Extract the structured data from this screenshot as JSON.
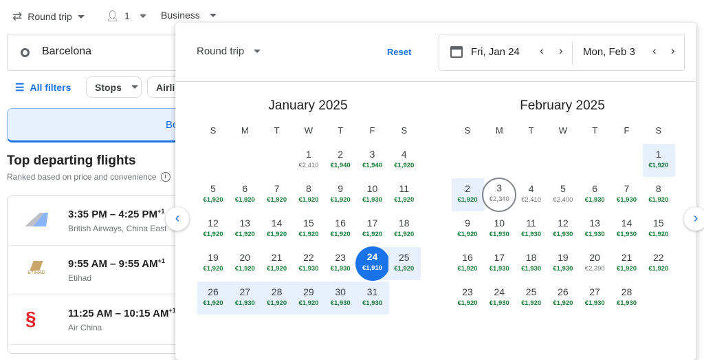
{
  "search": {
    "trip_type": "Round trip",
    "passengers": "1",
    "cabin": "Business",
    "origin": "Barcelona"
  },
  "filters": {
    "all_filters": "All filters",
    "stops": "Stops",
    "airlines": "Airlin"
  },
  "banner": {
    "text": "Be"
  },
  "results": {
    "title": "Top departing flights",
    "subtitle": "Ranked based on price and convenience",
    "flights": [
      {
        "time": "3:35 PM – 4:25 PM",
        "plus": "+1",
        "airline": "British Airways, China East"
      },
      {
        "time": "9:55 AM – 9:55 AM",
        "plus": "+1",
        "airline": "Etihad",
        "logo_text": "ETIHAD"
      },
      {
        "time": "11:25 AM – 10:15 AM",
        "plus": "+1",
        "airline": "Air China"
      }
    ]
  },
  "picker": {
    "trip_type": "Round trip",
    "reset": "Reset",
    "depart": "Fri, Jan 24",
    "return": "Mon, Feb 3",
    "weekdays": [
      "S",
      "M",
      "T",
      "W",
      "T",
      "F",
      "S"
    ],
    "colors": {
      "low": "#188038",
      "typical": "#70757a",
      "accent": "#1a73e8",
      "range": "#e8f0fe"
    },
    "months": [
      {
        "title": "January 2025",
        "first_weekday": 3,
        "selected_start": 24,
        "range": [
          25,
          31
        ],
        "days": [
          {
            "d": "1",
            "p": "€2,410",
            "l": "typical"
          },
          {
            "d": "2",
            "p": "€1,940",
            "l": "low"
          },
          {
            "d": "3",
            "p": "€1,940",
            "l": "low"
          },
          {
            "d": "4",
            "p": "€1,920",
            "l": "low"
          },
          {
            "d": "5",
            "p": "€1,920",
            "l": "low"
          },
          {
            "d": "6",
            "p": "€1,920",
            "l": "low"
          },
          {
            "d": "7",
            "p": "€1,920",
            "l": "low"
          },
          {
            "d": "8",
            "p": "€1,920",
            "l": "low"
          },
          {
            "d": "9",
            "p": "€1,920",
            "l": "low"
          },
          {
            "d": "10",
            "p": "€1,930",
            "l": "low"
          },
          {
            "d": "11",
            "p": "€1,920",
            "l": "low"
          },
          {
            "d": "12",
            "p": "€1,920",
            "l": "low"
          },
          {
            "d": "13",
            "p": "€1,920",
            "l": "low"
          },
          {
            "d": "14",
            "p": "€1,920",
            "l": "low"
          },
          {
            "d": "15",
            "p": "€1,920",
            "l": "low"
          },
          {
            "d": "16",
            "p": "€1,920",
            "l": "low"
          },
          {
            "d": "17",
            "p": "€1,920",
            "l": "low"
          },
          {
            "d": "18",
            "p": "€1,920",
            "l": "low"
          },
          {
            "d": "19",
            "p": "€1,920",
            "l": "low"
          },
          {
            "d": "20",
            "p": "€1,920",
            "l": "low"
          },
          {
            "d": "21",
            "p": "€1,920",
            "l": "low"
          },
          {
            "d": "22",
            "p": "€1,930",
            "l": "low"
          },
          {
            "d": "23",
            "p": "€1,930",
            "l": "low"
          },
          {
            "d": "24",
            "p": "€1,910",
            "l": "low"
          },
          {
            "d": "25",
            "p": "€1,920",
            "l": "low"
          },
          {
            "d": "26",
            "p": "€1,920",
            "l": "low"
          },
          {
            "d": "27",
            "p": "€1,930",
            "l": "low"
          },
          {
            "d": "28",
            "p": "€1,920",
            "l": "low"
          },
          {
            "d": "29",
            "p": "€1,920",
            "l": "low"
          },
          {
            "d": "30",
            "p": "€1,930",
            "l": "low"
          },
          {
            "d": "31",
            "p": "€1,930",
            "l": "low"
          }
        ]
      },
      {
        "title": "February 2025",
        "first_weekday": 6,
        "selected_end": 3,
        "range": [
          1,
          2
        ],
        "days": [
          {
            "d": "1",
            "p": "€1,920",
            "l": "low"
          },
          {
            "d": "2",
            "p": "€1,920",
            "l": "low"
          },
          {
            "d": "3",
            "p": "€2,340",
            "l": "typical"
          },
          {
            "d": "4",
            "p": "€2,410",
            "l": "typical"
          },
          {
            "d": "5",
            "p": "€2,400",
            "l": "typical"
          },
          {
            "d": "6",
            "p": "€1,930",
            "l": "low"
          },
          {
            "d": "7",
            "p": "€1,930",
            "l": "low"
          },
          {
            "d": "8",
            "p": "€1,920",
            "l": "low"
          },
          {
            "d": "9",
            "p": "€1,920",
            "l": "low"
          },
          {
            "d": "10",
            "p": "€1,930",
            "l": "low"
          },
          {
            "d": "11",
            "p": "€1,930",
            "l": "low"
          },
          {
            "d": "12",
            "p": "€1,930",
            "l": "low"
          },
          {
            "d": "13",
            "p": "€1,930",
            "l": "low"
          },
          {
            "d": "14",
            "p": "€1,930",
            "l": "low"
          },
          {
            "d": "15",
            "p": "€1,920",
            "l": "low"
          },
          {
            "d": "16",
            "p": "€1,920",
            "l": "low"
          },
          {
            "d": "17",
            "p": "€1,930",
            "l": "low"
          },
          {
            "d": "18",
            "p": "€1,930",
            "l": "low"
          },
          {
            "d": "19",
            "p": "€1,930",
            "l": "low"
          },
          {
            "d": "20",
            "p": "€2,390",
            "l": "typical"
          },
          {
            "d": "21",
            "p": "€1,920",
            "l": "low"
          },
          {
            "d": "22",
            "p": "€1,920",
            "l": "low"
          },
          {
            "d": "23",
            "p": "€1,920",
            "l": "low"
          },
          {
            "d": "24",
            "p": "€1,930",
            "l": "low"
          },
          {
            "d": "25",
            "p": "€1,920",
            "l": "low"
          },
          {
            "d": "26",
            "p": "€1,920",
            "l": "low"
          },
          {
            "d": "27",
            "p": "€1,930",
            "l": "low"
          },
          {
            "d": "28",
            "p": "€1,930",
            "l": "low"
          }
        ]
      }
    ]
  }
}
